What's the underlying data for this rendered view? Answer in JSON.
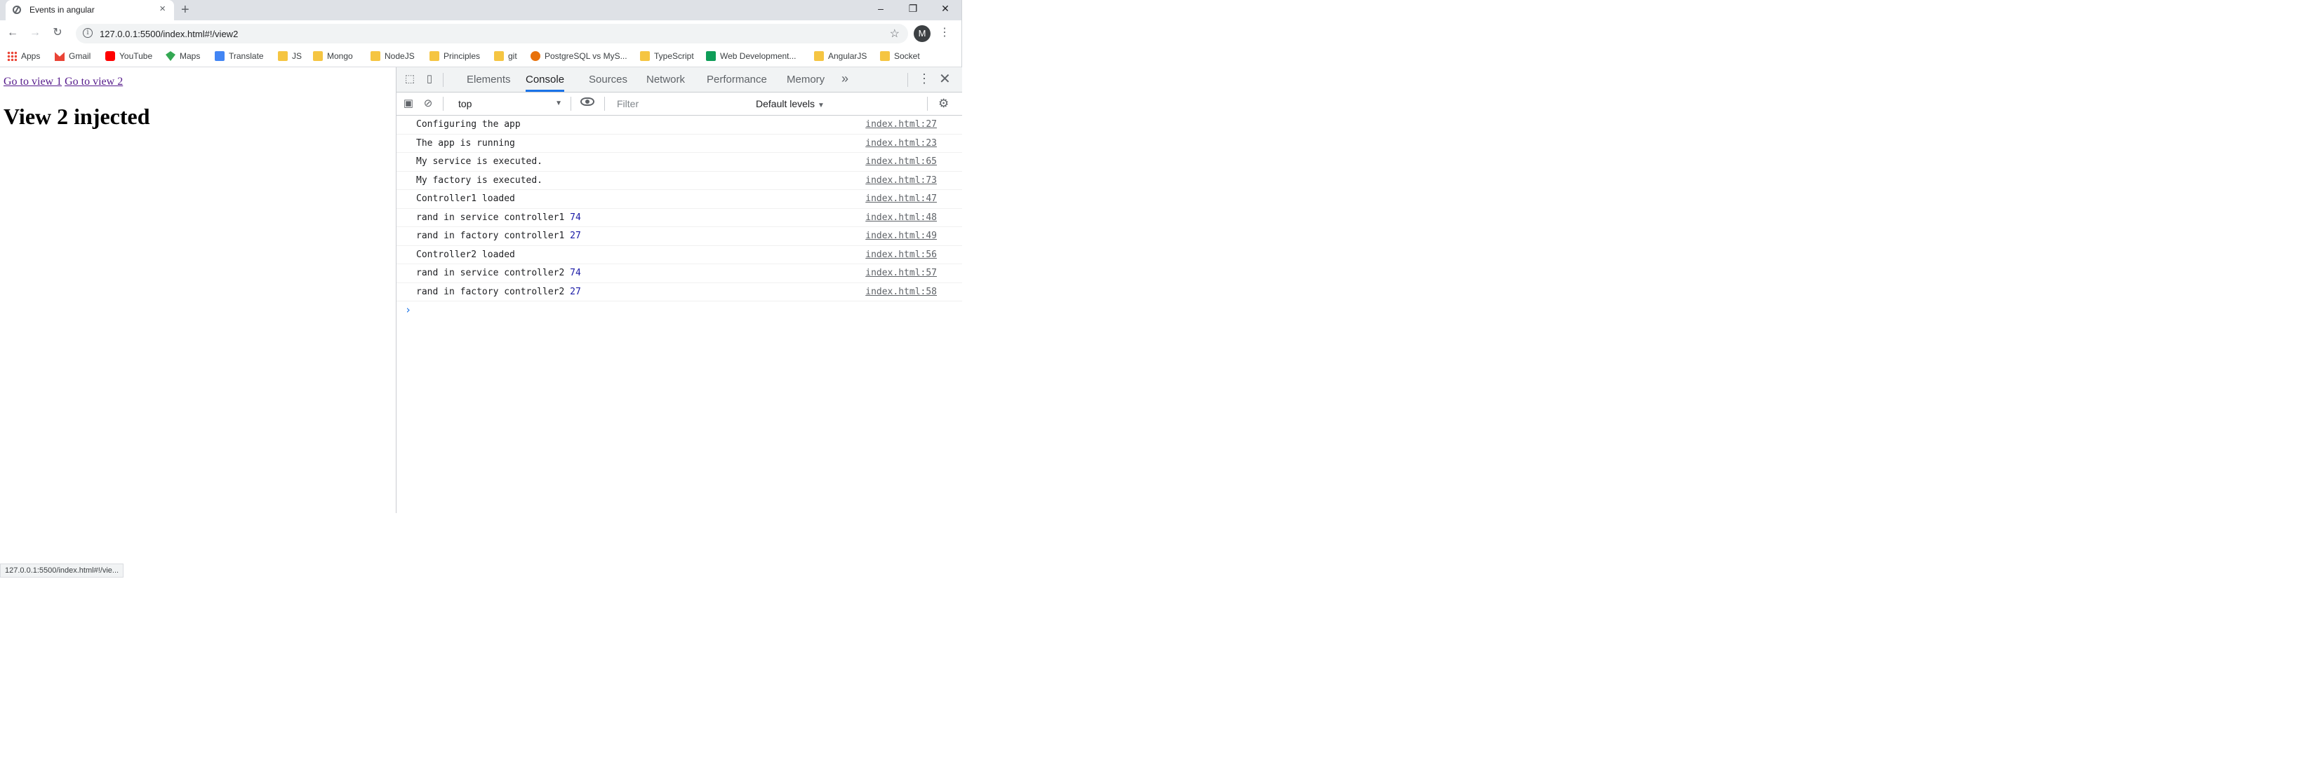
{
  "browser": {
    "tab_title": "Events in angular",
    "tab_close": "×",
    "new_tab": "+",
    "window_minimize": "–",
    "window_restore": "❐",
    "window_close": "✕",
    "url": "127.0.0.1:5500/index.html#!/view2",
    "avatar_letter": "M"
  },
  "bookmarks": [
    {
      "label": "Apps",
      "icon": "apps-grid-icon"
    },
    {
      "label": "Gmail",
      "icon": "gmail-icon"
    },
    {
      "label": "YouTube",
      "icon": "youtube-icon"
    },
    {
      "label": "Maps",
      "icon": "maps-icon"
    },
    {
      "label": "Translate",
      "icon": "translate-icon"
    },
    {
      "label": "JS",
      "icon": "folder-icon"
    },
    {
      "label": "Mongo",
      "icon": "folder-icon"
    },
    {
      "label": "NodeJS",
      "icon": "folder-icon"
    },
    {
      "label": "Principles",
      "icon": "folder-icon"
    },
    {
      "label": "git",
      "icon": "folder-icon"
    },
    {
      "label": "PostgreSQL vs MyS...",
      "icon": "postgres-icon"
    },
    {
      "label": "TypeScript",
      "icon": "folder-icon"
    },
    {
      "label": "Web Development...",
      "icon": "sheets-icon"
    },
    {
      "label": "AngularJS",
      "icon": "folder-icon"
    },
    {
      "label": "Socket",
      "icon": "folder-icon"
    }
  ],
  "page": {
    "link1": "Go to view 1",
    "link2": "Go to view 2",
    "heading": "View 2 injected",
    "status_url": "127.0.0.1:5500/index.html#!/vie..."
  },
  "devtools": {
    "tabs": [
      "Elements",
      "Console",
      "Sources",
      "Network",
      "Performance",
      "Memory"
    ],
    "active_tab": "Console",
    "more_tabs": "»",
    "context": "top",
    "filter_placeholder": "Filter",
    "levels": "Default levels",
    "console_rows": [
      {
        "text": "Configuring the app",
        "num": "",
        "source": "index.html:27"
      },
      {
        "text": "The app is running",
        "num": "",
        "source": "index.html:23"
      },
      {
        "text": "My service is executed.",
        "num": "",
        "source": "index.html:65"
      },
      {
        "text": "My factory is executed.",
        "num": "",
        "source": "index.html:73"
      },
      {
        "text": "Controller1 loaded",
        "num": "",
        "source": "index.html:47"
      },
      {
        "text": "rand in service controller1",
        "num": "74",
        "source": "index.html:48"
      },
      {
        "text": "rand in factory controller1",
        "num": "27",
        "source": "index.html:49"
      },
      {
        "text": "Controller2 loaded",
        "num": "",
        "source": "index.html:56"
      },
      {
        "text": "rand in service controller2",
        "num": "74",
        "source": "index.html:57"
      },
      {
        "text": "rand in factory controller2",
        "num": "27",
        "source": "index.html:58"
      }
    ],
    "prompt": "›"
  }
}
